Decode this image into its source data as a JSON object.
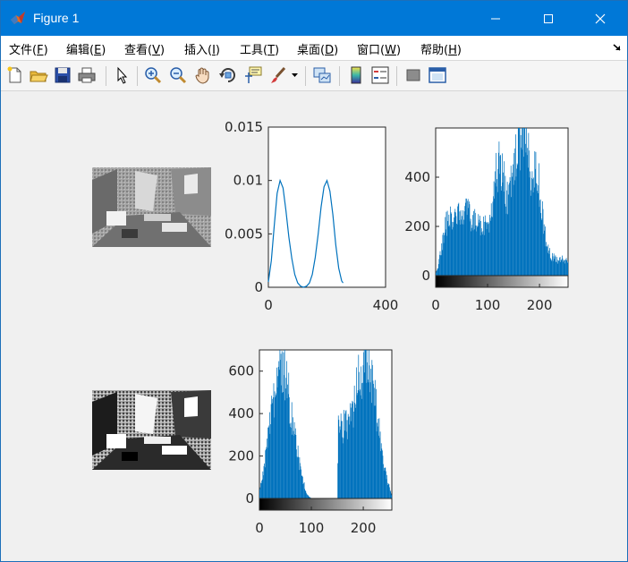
{
  "window": {
    "title": "Figure 1"
  },
  "menu": {
    "items": [
      {
        "label": "文件(F)",
        "base": "文件(",
        "key": "F"
      },
      {
        "label": "编辑(E)",
        "base": "编辑(",
        "key": "E"
      },
      {
        "label": "查看(V)",
        "base": "查看(",
        "key": "V"
      },
      {
        "label": "插入(I)",
        "base": "插入(",
        "key": "I"
      },
      {
        "label": "工具(T)",
        "base": "工具(",
        "key": "T"
      },
      {
        "label": "桌面(D)",
        "base": "桌面(",
        "key": "D"
      },
      {
        "label": "窗口(W)",
        "base": "窗口(",
        "key": "W"
      },
      {
        "label": "帮助(H)",
        "base": "帮助(",
        "key": "H"
      }
    ]
  },
  "toolbar": {
    "icons": [
      "new-figure-icon",
      "open-file-icon",
      "save-icon",
      "print-icon",
      "select-arrow-icon",
      "zoom-in-icon",
      "zoom-out-icon",
      "pan-hand-icon",
      "rotate-3d-icon",
      "data-cursor-icon",
      "brush-icon",
      "link-plot-icon",
      "colorbar-icon",
      "legend-icon",
      "hide-plot-tools-icon",
      "show-plot-tools-icon"
    ]
  },
  "chart_data": [
    {
      "type": "line",
      "title": "",
      "xlabel": "",
      "ylabel": "",
      "xlim": [
        0,
        400
      ],
      "ylim": [
        0,
        0.015
      ],
      "x_ticks": [
        "0",
        "400"
      ],
      "y_ticks": [
        "0",
        "0.005",
        "0.01",
        "0.015"
      ],
      "series": [
        {
          "color": "#0072bd",
          "x": [
            0,
            10,
            20,
            30,
            40,
            50,
            60,
            70,
            80,
            90,
            100,
            110,
            120,
            130,
            140,
            150,
            160,
            170,
            180,
            190,
            200,
            210,
            220,
            230,
            240,
            250,
            255
          ],
          "y": [
            0.0005,
            0.0025,
            0.0058,
            0.0088,
            0.01,
            0.0093,
            0.0072,
            0.0047,
            0.0027,
            0.0012,
            0.0004,
            0.0001,
            0.0,
            0.0001,
            0.0004,
            0.0012,
            0.0028,
            0.005,
            0.0075,
            0.0094,
            0.01,
            0.009,
            0.0068,
            0.004,
            0.0018,
            0.0006,
            0.0004
          ]
        }
      ]
    },
    {
      "type": "bar",
      "title": "",
      "xlim": [
        0,
        255
      ],
      "ylim": [
        0,
        600
      ],
      "x_ticks": [
        "0",
        "100",
        "200"
      ],
      "y_ticks": [
        "0",
        "200",
        "400"
      ],
      "colorbar": "gray",
      "color": "#0072bd",
      "envelope_x": [
        0,
        5,
        10,
        15,
        20,
        30,
        40,
        50,
        55,
        60,
        70,
        80,
        90,
        100,
        105,
        110,
        115,
        120,
        125,
        130,
        135,
        140,
        145,
        150,
        155,
        160,
        165,
        170,
        175,
        180,
        185,
        190,
        195,
        200,
        205,
        210,
        215,
        220,
        225,
        230,
        235,
        240,
        245,
        250,
        255
      ],
      "envelope_y": [
        10,
        40,
        110,
        170,
        210,
        240,
        255,
        280,
        265,
        255,
        230,
        220,
        210,
        215,
        240,
        320,
        420,
        460,
        480,
        405,
        330,
        330,
        390,
        450,
        500,
        560,
        570,
        640,
        520,
        450,
        380,
        420,
        420,
        360,
        280,
        180,
        120,
        90,
        75,
        70,
        65,
        70,
        65,
        60,
        55
      ]
    },
    {
      "type": "bar",
      "title": "",
      "xlim": [
        0,
        255
      ],
      "ylim": [
        0,
        700
      ],
      "x_ticks": [
        "0",
        "100",
        "200"
      ],
      "y_ticks": [
        "0",
        "200",
        "400",
        "600"
      ],
      "colorbar": "gray",
      "color": "#0072bd",
      "envelope_x": [
        0,
        5,
        10,
        15,
        20,
        25,
        30,
        35,
        40,
        45,
        50,
        55,
        60,
        65,
        70,
        75,
        80,
        85,
        90,
        95,
        100,
        105,
        110,
        130,
        150,
        152,
        160,
        170,
        180,
        185,
        190,
        195,
        200,
        205,
        210,
        215,
        220,
        225,
        230,
        235,
        240,
        245,
        250,
        255
      ],
      "envelope_y": [
        40,
        90,
        170,
        260,
        370,
        460,
        520,
        580,
        640,
        600,
        560,
        510,
        420,
        340,
        250,
        190,
        120,
        70,
        30,
        10,
        0,
        0,
        0,
        0,
        0,
        340,
        340,
        360,
        380,
        480,
        560,
        600,
        620,
        700,
        600,
        560,
        500,
        420,
        340,
        230,
        160,
        100,
        60,
        20
      ]
    }
  ]
}
